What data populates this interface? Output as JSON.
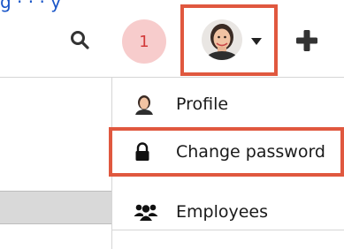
{
  "header": {
    "partial_link_text": "g  ·  ·  ·  y",
    "notification_count": "1"
  },
  "profile_menu": {
    "items": [
      {
        "label": "Profile",
        "icon": "avatar-icon"
      },
      {
        "label": "Change password",
        "icon": "lock-icon"
      },
      {
        "label": "Employees",
        "icon": "users-icon"
      }
    ]
  },
  "colors": {
    "highlight": "#e0583f",
    "badge_bg": "#f7cccc",
    "badge_text": "#d23a3a",
    "link": "#1a56c8"
  }
}
